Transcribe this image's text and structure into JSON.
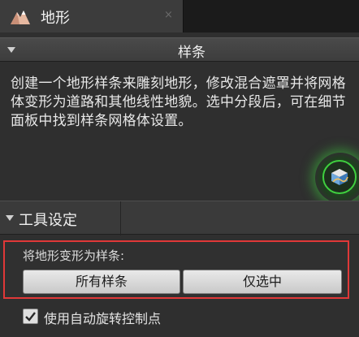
{
  "tab": {
    "title": "地形",
    "close_glyph": "×",
    "icon": "landscape-mountain-icon"
  },
  "spline_section": {
    "title": "样条",
    "description": "创建一个地形样条来雕刻地形，修改混合遮罩并将网格体变形为道路和其他线性地貌。选中分段后，可在细节面板中找到样条网格体设置。",
    "tool_icon": "spline-cube-icon",
    "tool_glow_color": "#3fcf3f"
  },
  "tool_settings": {
    "title": "工具设定",
    "deform_label": "将地形变形为样条:",
    "all_splines_button": "所有样条",
    "only_selected_button": "仅选中",
    "highlight_color": "#e03838",
    "auto_rotate_checkbox": {
      "label": "使用自动旋转控制点",
      "checked": true
    }
  }
}
